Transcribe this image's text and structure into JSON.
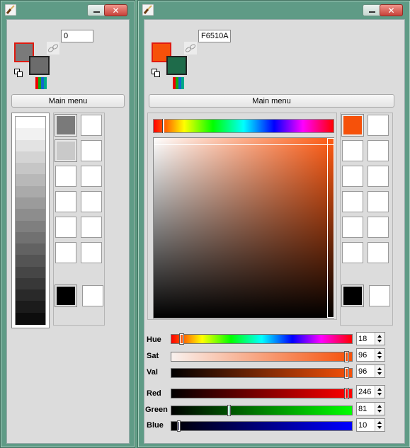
{
  "left_window": {
    "hex_value": "0",
    "fg_color": "#7a7a7a",
    "bg_color": "#6c6c6c",
    "main_menu_label": "Main menu",
    "gray_ramp": [
      "#ffffff",
      "#f1f1f1",
      "#e3e3e3",
      "#d4d4d4",
      "#c6c6c6",
      "#b8b8b8",
      "#aaaaaa",
      "#9b9b9b",
      "#8d8d8d",
      "#7f7f7f",
      "#717171",
      "#626262",
      "#545454",
      "#464646",
      "#383838",
      "#292929",
      "#1b1b1b",
      "#0d0d0d"
    ],
    "palette": [
      "#7a7a7a",
      "#ffffff",
      "#c9c9c9",
      "#ffffff",
      "#ffffff",
      "#ffffff",
      "#ffffff",
      "#ffffff",
      "#ffffff",
      "#ffffff",
      "#ffffff",
      "#ffffff"
    ],
    "extra_swatches": [
      "#000000",
      "#ffffff"
    ]
  },
  "right_window": {
    "hex_value": "F6510A",
    "fg_color": "#f6510a",
    "bg_color": "#1e6b4a",
    "main_menu_label": "Main menu",
    "palette": [
      "#f6510a",
      "#ffffff",
      "#ffffff",
      "#ffffff",
      "#ffffff",
      "#ffffff",
      "#ffffff",
      "#ffffff",
      "#ffffff",
      "#ffffff",
      "#ffffff",
      "#ffffff"
    ],
    "extra_swatches": [
      "#000000",
      "#ffffff"
    ],
    "sliders": [
      {
        "label": "Hue",
        "value": "18"
      },
      {
        "label": "Sat",
        "value": "96"
      },
      {
        "label": "Val",
        "value": "96"
      },
      {
        "label": "Red",
        "value": "246"
      },
      {
        "label": "Green",
        "value": "81"
      },
      {
        "label": "Blue",
        "value": "10"
      }
    ]
  },
  "icons": {
    "app": "paintbrush-icon",
    "minimize": "minimize-icon",
    "close": "close-icon",
    "link": "link-icon",
    "swap": "swap-colors-icon",
    "spectrum": "spectrum-icon"
  }
}
